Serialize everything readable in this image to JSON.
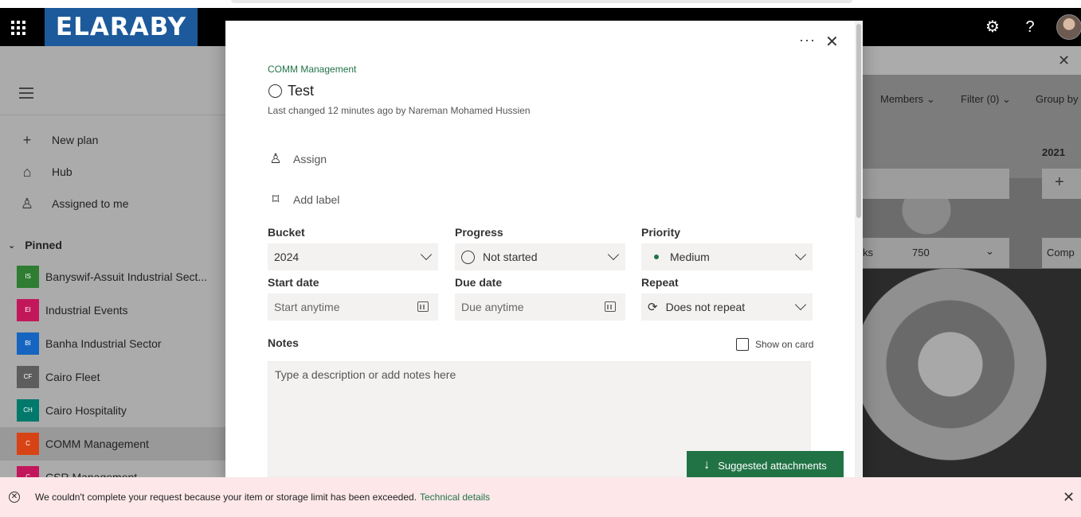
{
  "header": {
    "brand": "ELARABY",
    "settings_icon": "gear-icon",
    "help": "?"
  },
  "left_nav": {
    "items": [
      {
        "icon": "plus-icon",
        "label": "New plan"
      },
      {
        "icon": "home-icon",
        "label": "Hub"
      },
      {
        "icon": "person-icon",
        "label": "Assigned to me"
      }
    ],
    "pinned_label": "Pinned",
    "plans": [
      {
        "initials": "IS",
        "label": "Banyswif-Assuit Industrial Sect...",
        "color": "#2e7d32"
      },
      {
        "initials": "EI",
        "label": "Industrial Events",
        "color": "#c2185b"
      },
      {
        "initials": "BI",
        "label": "Banha Industrial Sector",
        "color": "#1565c0"
      },
      {
        "initials": "CF",
        "label": "Cairo Fleet",
        "color": "#5d5d5d"
      },
      {
        "initials": "CH",
        "label": "Cairo Hospitality",
        "color": "#00796b"
      },
      {
        "initials": "C",
        "label": "COMM Management",
        "color": "#d84315"
      },
      {
        "initials": "C",
        "label": "CSR Management",
        "color": "#c2185b"
      }
    ]
  },
  "board": {
    "members": "Members",
    "filter": "Filter (0)",
    "group_by": "Group by",
    "year": "2021",
    "tasks_suffix": "ks",
    "count": "750",
    "comp": "Comp"
  },
  "task": {
    "plan_name": "COMM Management",
    "title": "Test",
    "last_changed": "Last changed 12 minutes ago by Nareman Mohamed Hussien",
    "assign": "Assign",
    "add_label": "Add label",
    "bucket": {
      "label": "Bucket",
      "value": "2024"
    },
    "progress": {
      "label": "Progress",
      "value": "Not started"
    },
    "priority": {
      "label": "Priority",
      "value": "Medium"
    },
    "start_date": {
      "label": "Start date",
      "placeholder": "Start anytime"
    },
    "due_date": {
      "label": "Due date",
      "placeholder": "Due anytime"
    },
    "repeat": {
      "label": "Repeat",
      "value": "Does not repeat"
    },
    "notes": {
      "label": "Notes",
      "placeholder": "Type a description or add notes here"
    },
    "show_on_card": "Show on card",
    "suggested_attachments": "Suggested attachments"
  },
  "error": {
    "message": "We couldn't complete your request because your item or storage limit has been exceeded.",
    "link": "Technical details"
  },
  "colors": {
    "accent": "#217346",
    "topbar": "#000000",
    "brand": "#1d5a9b",
    "error_bg": "#fde7e9"
  }
}
